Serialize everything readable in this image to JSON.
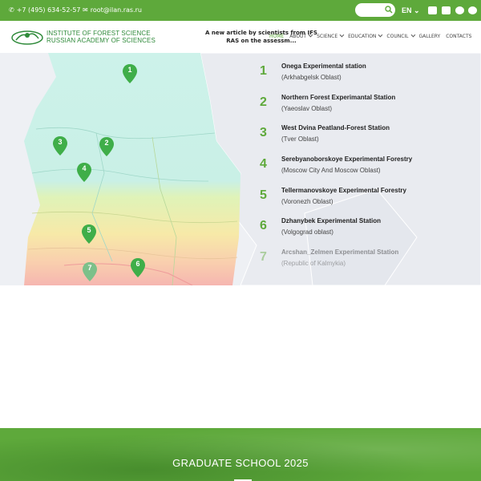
{
  "topbar": {
    "phone": "+7 (495) 634-52-57",
    "email": "root@ilan.ras.ru",
    "language": "EN",
    "search": {
      "placeholder": ""
    }
  },
  "header": {
    "logo_line1": "INSTITUTE OF FOREST SCIENCE",
    "logo_line2": "RUSSIAN ACADEMY OF SCIENCES",
    "news_line1": "A new article by scientists from IFS",
    "news_line2": "RAS on the assessm...",
    "nav": [
      {
        "label": "HOME"
      },
      {
        "label": "ABOUT"
      },
      {
        "label": "SCIENCE"
      },
      {
        "label": "EDUCATION"
      },
      {
        "label": "COUNCIL"
      },
      {
        "label": "GALLERY"
      },
      {
        "label": "CONTACTS"
      }
    ]
  },
  "stations": [
    {
      "num": "1",
      "name": "Onega Experimental station",
      "region": "(Arkhabgelsk Oblast)"
    },
    {
      "num": "2",
      "name": "Northern Forest Experimantal Station",
      "region": "(Yaeoslav Oblast)"
    },
    {
      "num": "3",
      "name": "West Dvina Peatland-Forest Station",
      "region": "(Tver Oblast)"
    },
    {
      "num": "4",
      "name": "Serebyanoborskoye Experimental Forestry",
      "region": "(Moscow City And Moscow Oblast)"
    },
    {
      "num": "5",
      "name": "Tellermanovskoye Experimental Forestry",
      "region": "(Voronezh Oblast)"
    },
    {
      "num": "6",
      "name": "Dzhanybek Experimental Station",
      "region": "(Volgograd oblast)"
    },
    {
      "num": "7",
      "name": "Arcshan_Zelmen Experimental Station",
      "region": "(Republic of Kalmykia)"
    }
  ],
  "banner": {
    "title": "GRADUATE SCHOOL 2025"
  },
  "colors": {
    "brand_green": "#5ea93b",
    "pin_green": "#3fae49",
    "map_zone_teal": "#c9f0e6"
  }
}
